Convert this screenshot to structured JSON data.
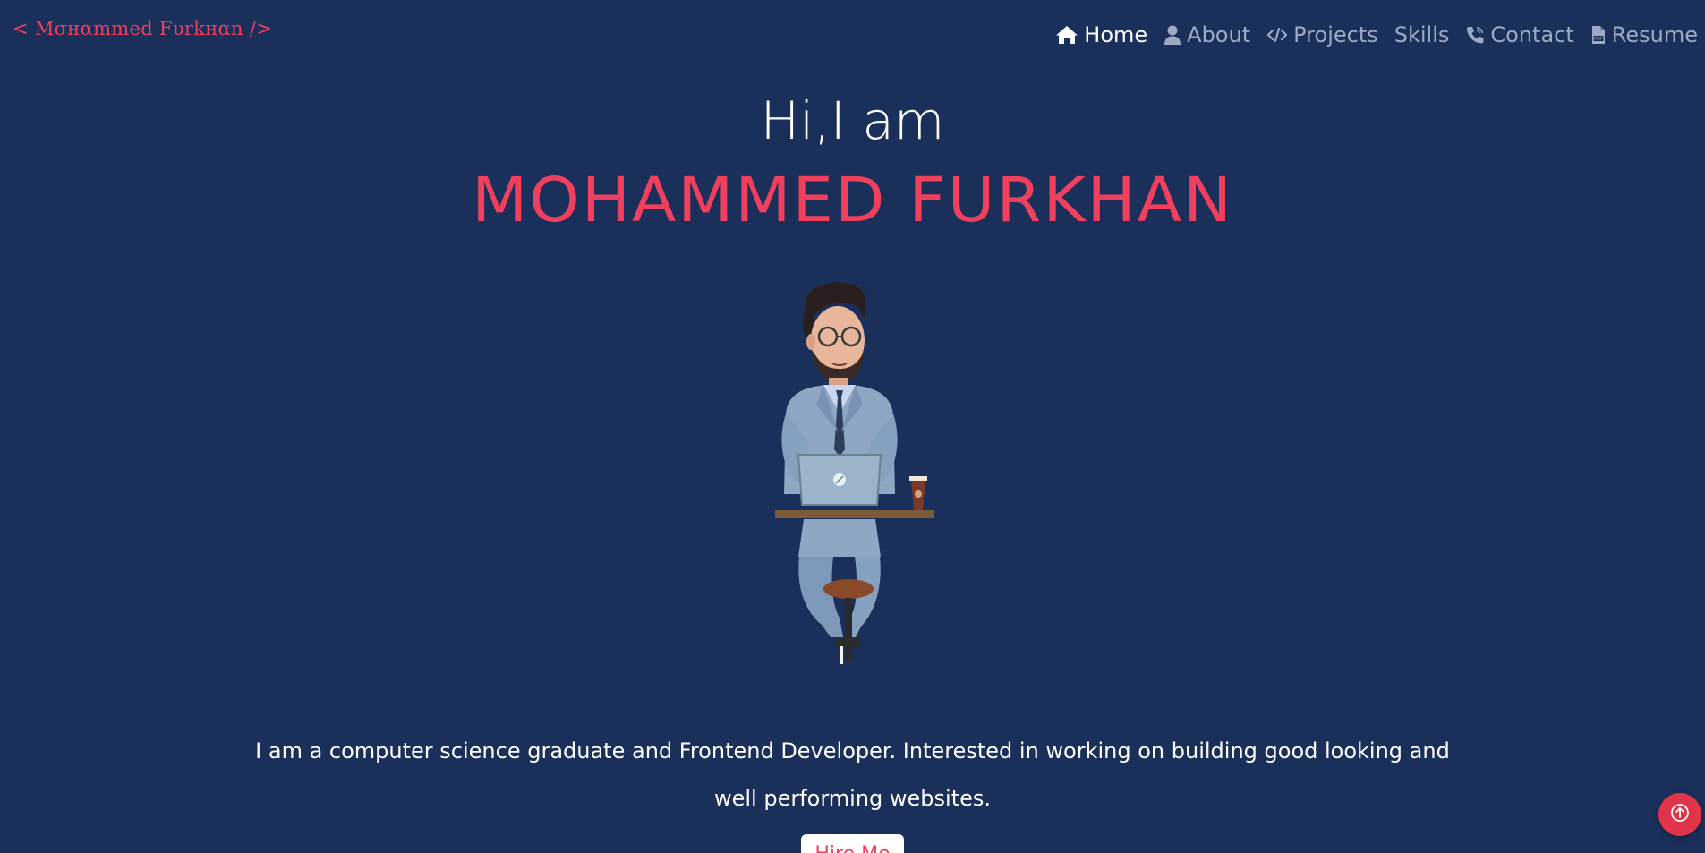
{
  "header": {
    "logo_text": "< Mσнαmmed Fυrkнαn />",
    "nav": [
      {
        "label": "Home",
        "icon": "home-icon",
        "active": true
      },
      {
        "label": "About",
        "icon": "user-icon",
        "active": false
      },
      {
        "label": "Projects",
        "icon": "code-icon",
        "active": false
      },
      {
        "label": "Skills",
        "icon": "",
        "active": false
      },
      {
        "label": "Contact",
        "icon": "phone-icon",
        "active": false
      },
      {
        "label": "Resume",
        "icon": "pdf-file-icon",
        "active": false
      }
    ]
  },
  "hero": {
    "greeting": "Hi,I am",
    "name": "MOHAMMED FURKHAN",
    "avatar_icon": "developer-avatar-illustration",
    "bio": "I am a computer science graduate and Frontend Developer. Interested in working on building good looking and well performing websites.",
    "hire_button_label": "Hire Me"
  },
  "floating": {
    "scroll_top_icon": "arrow-up-circle-icon"
  },
  "colors": {
    "background": "#1b2f5b",
    "accent": "#f0405d",
    "nav_inactive": "#9ea9c4",
    "text": "#ffffff"
  }
}
